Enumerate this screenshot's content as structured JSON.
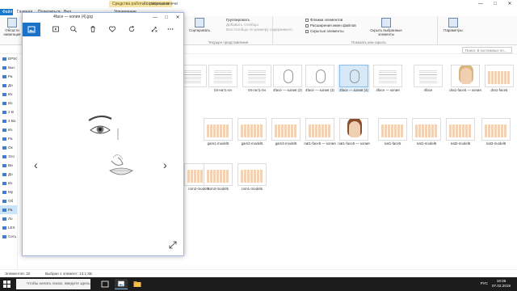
{
  "explorer": {
    "context_tab": "Средства работы с рисунками",
    "window_title": "Костюмные плечи",
    "tabs": [
      "Файл",
      "Главная",
      "Поделиться",
      "Вид",
      "Управление"
    ],
    "ribbon": {
      "pane_btn": "Области навигации",
      "sort_btn": "Сортировать",
      "group_by": "Группировать",
      "add_columns": "Добавить столбцы",
      "fit_columns": "Все столбцы по размеру содержимого",
      "current_view_label": "Текущее представление",
      "checkbox_items": "Флажки элементов",
      "checkbox_ext": "Расширения имен файлов",
      "checkbox_hidden": "Скрытые элементы",
      "hide_selected": "Скрыть выбранные элементы",
      "show_hide_label": "Показать или скрыть",
      "options_btn": "Параметры"
    },
    "search_placeholder": "Поиск: В костюмных пл...",
    "nav_items": [
      "EPSON",
      "Быс",
      "Ра",
      "До",
      "Из",
      "Из",
      "2 В",
      "4 Во",
      "Из",
      "Ра",
      "Ок",
      "Это",
      "Ви",
      "До",
      "Из",
      "Му",
      "Об",
      "Ра",
      "Ло",
      "LEX",
      "Сеть"
    ],
    "thumbnails": [
      {
        "cap": "",
        "kind": "doc"
      },
      {
        "cap": "04-нат1-пн",
        "kind": "doc"
      },
      {
        "cap": "04-пнт1-пн",
        "kind": "doc"
      },
      {
        "cap": "4face — копия (2)",
        "kind": "sketch"
      },
      {
        "cap": "4face — копия (3)",
        "kind": "sketch"
      },
      {
        "cap": "4face — копия (4)",
        "kind": "sketch",
        "sel": true
      },
      {
        "cap": "4face — копия",
        "kind": "doc"
      },
      {
        "cap": "4face",
        "kind": "doc"
      },
      {
        "cap": "dra1-face5 — копия",
        "kind": "portrait-light"
      },
      {
        "cap": "dra1-face5",
        "kind": "figrow"
      },
      {
        "cap": "gam1-model5",
        "kind": "figrow"
      },
      {
        "cap": "gam2-model5",
        "kind": "figrow"
      },
      {
        "cap": "gam3-model5",
        "kind": "figrow"
      },
      {
        "cap": "nat1-face5 — копия",
        "kind": "figrow"
      },
      {
        "cap": "nat1-face5 — копия",
        "kind": "portrait-dark"
      },
      {
        "cap": "nat1-face5",
        "kind": "figrow"
      },
      {
        "cap": "nat1-model5",
        "kind": "figrow"
      },
      {
        "cap": "nat2-model5",
        "kind": "figrow"
      },
      {
        "cap": "nat3-model5",
        "kind": "figrow"
      },
      {
        "cap": "rom2-model5",
        "kind": "figrow"
      },
      {
        "cap": "rom3-model5",
        "kind": "figrow"
      },
      {
        "cap": "rom1-model5",
        "kind": "figrow"
      }
    ],
    "status_count": "Элементов: 32",
    "status_selected": "Выбран 1 элемент: 13,1 КБ"
  },
  "viewer": {
    "title": "4face — копия (4).jpg",
    "controls": [
      "—",
      "□",
      "✕"
    ],
    "tools": [
      "image-icon",
      "slideshow-icon",
      "zoom-icon",
      "delete-icon",
      "favorite-icon",
      "rotate-icon",
      "edit-icon",
      "more-icon"
    ]
  },
  "taskbar": {
    "search_text": "Чтобы начать поиск, введите здесь запрос",
    "lang": "РУС",
    "time": "19:36",
    "date": "07.02.2019"
  },
  "colors": {
    "accent": "#1a73c8",
    "taskbar": "#1c1c1c",
    "context_tab": "#f5e6a8"
  }
}
